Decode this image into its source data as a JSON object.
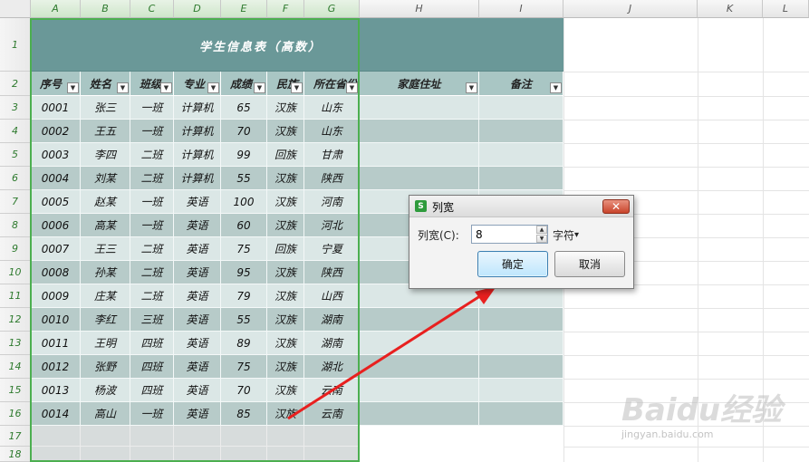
{
  "columns": [
    "A",
    "B",
    "C",
    "D",
    "E",
    "F",
    "G",
    "H",
    "I",
    "J",
    "K",
    "L"
  ],
  "rows": [
    "1",
    "2",
    "3",
    "4",
    "5",
    "6",
    "7",
    "8",
    "9",
    "10",
    "11",
    "12",
    "13",
    "14",
    "15",
    "16",
    "17",
    "18"
  ],
  "title": "学生信息表（高数）",
  "headers": [
    "序号",
    "姓名",
    "班级",
    "专业",
    "成绩",
    "民族",
    "所在省份",
    "家庭住址",
    "备注"
  ],
  "data": [
    [
      "0001",
      "张三",
      "一班",
      "计算机",
      "65",
      "汉族",
      "山东"
    ],
    [
      "0002",
      "王五",
      "一班",
      "计算机",
      "70",
      "汉族",
      "山东"
    ],
    [
      "0003",
      "李四",
      "二班",
      "计算机",
      "99",
      "回族",
      "甘肃"
    ],
    [
      "0004",
      "刘某",
      "二班",
      "计算机",
      "55",
      "汉族",
      "陕西"
    ],
    [
      "0005",
      "赵某",
      "一班",
      "英语",
      "100",
      "汉族",
      "河南"
    ],
    [
      "0006",
      "高某",
      "一班",
      "英语",
      "60",
      "汉族",
      "河北"
    ],
    [
      "0007",
      "王三",
      "二班",
      "英语",
      "75",
      "回族",
      "宁夏"
    ],
    [
      "0008",
      "孙某",
      "二班",
      "英语",
      "95",
      "汉族",
      "陕西"
    ],
    [
      "0009",
      "庄某",
      "二班",
      "英语",
      "79",
      "汉族",
      "山西"
    ],
    [
      "0010",
      "李红",
      "三班",
      "英语",
      "55",
      "汉族",
      "湖南"
    ],
    [
      "0011",
      "王明",
      "四班",
      "英语",
      "89",
      "汉族",
      "湖南"
    ],
    [
      "0012",
      "张野",
      "四班",
      "英语",
      "75",
      "汉族",
      "湖北"
    ],
    [
      "0013",
      "杨波",
      "四班",
      "英语",
      "70",
      "汉族",
      "云南"
    ],
    [
      "0014",
      "高山",
      "一班",
      "英语",
      "85",
      "汉族",
      "云南"
    ]
  ],
  "filter_glyph": "▼",
  "dialog": {
    "icon_letter": "S",
    "title": "列宽",
    "close_glyph": "✕",
    "label": "列宽(C):",
    "value": "8",
    "unit": "字符",
    "unit_arrow": "▾",
    "ok": "确定",
    "cancel": "取消",
    "spin_up": "▲",
    "spin_down": "▼"
  },
  "watermark": {
    "logo": "Baidu经验",
    "url": "jingyan.baidu.com"
  },
  "colors": {
    "title_band": "#6a9898",
    "header_row": "#a9c6c4",
    "row_dark": "#b7cbc9",
    "row_light": "#dbe7e6",
    "selection": "#4caf50",
    "arrow": "#e8201f"
  }
}
